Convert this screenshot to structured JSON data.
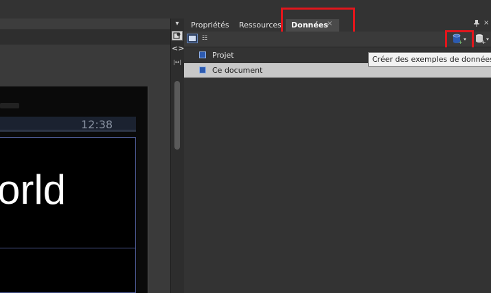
{
  "artboard": {
    "status_time": "12:38",
    "hello_text": "orld"
  },
  "tabs": [
    {
      "label": "Propriétés"
    },
    {
      "label": "Ressources"
    },
    {
      "label": "Données",
      "close": "×"
    }
  ],
  "panel": {
    "rows": [
      {
        "label": "Projet"
      },
      {
        "label": "Ce document"
      }
    ],
    "tooltip": "Créer des exemples de données"
  },
  "colors": {
    "highlight": "#e2161c",
    "selected_row": "#c8c8c8",
    "db_icon": "#2d5bb0"
  },
  "icons": [
    "pin-icon",
    "close-icon",
    "list-view-icon",
    "tree-view-icon",
    "database-create-icon",
    "database-add-icon",
    "artboard-tool-icon",
    "code-toggle-icon",
    "ruler-icon"
  ]
}
